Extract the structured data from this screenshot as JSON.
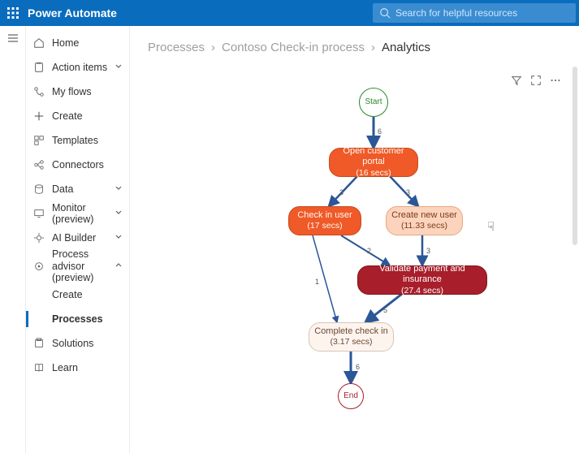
{
  "app": {
    "title": "Power Automate"
  },
  "search": {
    "placeholder": "Search for helpful resources"
  },
  "sidebar": {
    "items": [
      {
        "label": "Home"
      },
      {
        "label": "Action items"
      },
      {
        "label": "My flows"
      },
      {
        "label": "Create"
      },
      {
        "label": "Templates"
      },
      {
        "label": "Connectors"
      },
      {
        "label": "Data"
      },
      {
        "label": "Monitor (preview)"
      },
      {
        "label": "AI Builder"
      },
      {
        "label": "Process advisor (preview)"
      },
      {
        "label": "Solutions"
      },
      {
        "label": "Learn"
      }
    ],
    "pa_children": [
      {
        "label": "Create"
      },
      {
        "label": "Processes"
      }
    ]
  },
  "breadcrumb": {
    "a": "Processes",
    "b": "Contoso Check-in process",
    "c": "Analytics"
  },
  "flow": {
    "start": "Start",
    "end": "End",
    "nodes": [
      {
        "title": "Open customer portal",
        "sub": "(16 secs)"
      },
      {
        "title": "Check in user",
        "sub": "(17 secs)"
      },
      {
        "title": "Create new user",
        "sub": "(11.33 secs)"
      },
      {
        "title": "Validate payment and insurance",
        "sub": "(27.4 secs)"
      },
      {
        "title": "Complete check in",
        "sub": "(3.17 secs)"
      }
    ],
    "edges": {
      "start_open": "6",
      "open_checkin": "3",
      "open_create": "3",
      "checkin_validate": "2",
      "create_validate": "3",
      "checkin_complete": "1",
      "validate_complete": "5",
      "complete_end": "6"
    }
  },
  "chart_data": {
    "type": "flow",
    "nodes": [
      {
        "id": "start",
        "label": "Start"
      },
      {
        "id": "open",
        "label": "Open customer portal",
        "duration_secs": 16
      },
      {
        "id": "checkin",
        "label": "Check in user",
        "duration_secs": 17
      },
      {
        "id": "create",
        "label": "Create new user",
        "duration_secs": 11.33
      },
      {
        "id": "validate",
        "label": "Validate payment and insurance",
        "duration_secs": 27.4
      },
      {
        "id": "complete",
        "label": "Complete check in",
        "duration_secs": 3.17
      },
      {
        "id": "end",
        "label": "End"
      }
    ],
    "edges": [
      {
        "from": "start",
        "to": "open",
        "count": 6
      },
      {
        "from": "open",
        "to": "checkin",
        "count": 3
      },
      {
        "from": "open",
        "to": "create",
        "count": 3
      },
      {
        "from": "checkin",
        "to": "validate",
        "count": 2
      },
      {
        "from": "create",
        "to": "validate",
        "count": 3
      },
      {
        "from": "checkin",
        "to": "complete",
        "count": 1
      },
      {
        "from": "validate",
        "to": "complete",
        "count": 5
      },
      {
        "from": "complete",
        "to": "end",
        "count": 6
      }
    ]
  }
}
